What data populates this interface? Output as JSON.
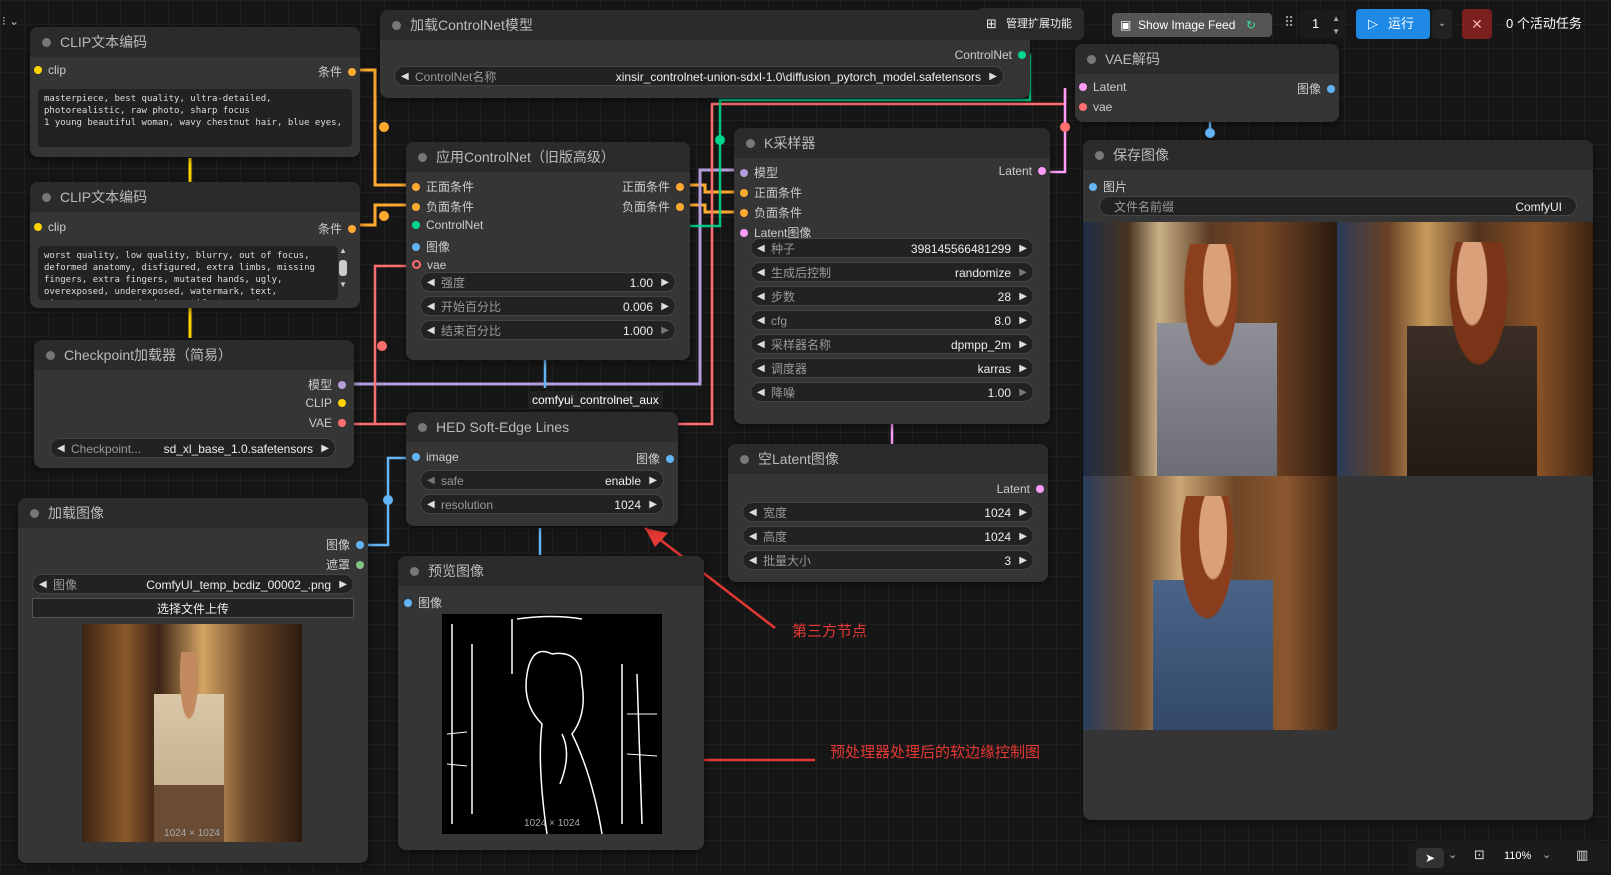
{
  "toolbar": {
    "manager_label": "管理扩展功能",
    "image_feed_label": "Show Image Feed",
    "queue_count": "1",
    "run_label": "运行",
    "active_tasks": "0 个活动任务"
  },
  "nodes": {
    "clip_pos": {
      "title": "CLIP文本编码",
      "in_clip": "clip",
      "out_cond": "条件",
      "text": "masterpiece, best quality, ultra-detailed, photorealistic, raw photo, sharp focus\n1 young beautiful woman, wavy chestnut hair, blue eyes,"
    },
    "clip_neg": {
      "title": "CLIP文本编码",
      "in_clip": "clip",
      "out_cond": "条件",
      "text": "worst quality, low quality, blurry, out of focus, deformed anatomy, disfigured, extra limbs, missing fingers, extra fingers, mutated hands, ugly, overexposed, underexposed, watermark, text, signature, cropped, jpeg artifacts, grainy"
    },
    "checkpoint": {
      "title": "Checkpoint加载器（简易）",
      "out_model": "模型",
      "out_clip": "CLIP",
      "out_vae": "VAE",
      "w_label": "Checkpoint...",
      "w_value": "sd_xl_base_1.0.safetensors"
    },
    "load_image": {
      "title": "加载图像",
      "out_image": "图像",
      "out_mask": "遮罩",
      "w_label": "图像",
      "w_value": "ComfyUI_temp_bcdiz_00002_.png",
      "upload_label": "选择文件上传",
      "caption": "1024 × 1024"
    },
    "cn_loader": {
      "title": "加载ControlNet模型",
      "out": "ControlNet",
      "w_label": "ControlNet名称",
      "w_value": "xinsir_controlnet-union-sdxl-1.0\\diffusion_pytorch_model.safetensors"
    },
    "apply_cn": {
      "title": "应用ControlNet（旧版高级）",
      "in_pos": "正面条件",
      "in_neg": "负面条件",
      "in_cn": "ControlNet",
      "in_image": "图像",
      "in_vae": "vae",
      "out_pos": "正面条件",
      "out_neg": "负面条件",
      "w1_label": "强度",
      "w1_value": "1.00",
      "w2_label": "开始百分比",
      "w2_value": "0.006",
      "w3_label": "结束百分比",
      "w3_value": "1.000"
    },
    "hed": {
      "title": "HED Soft-Edge Lines",
      "badge": "comfyui_controlnet_aux",
      "in_image": "image",
      "out_image": "图像",
      "w1_label": "safe",
      "w1_value": "enable",
      "w2_label": "resolution",
      "w2_value": "1024"
    },
    "preview": {
      "title": "预览图像",
      "in_image": "图像",
      "caption": "1024 × 1024"
    },
    "ksampler": {
      "title": "K采样器",
      "in_model": "模型",
      "in_pos": "正面条件",
      "in_neg": "负面条件",
      "in_latent": "Latent图像",
      "out_latent": "Latent",
      "widgets": [
        {
          "label": "种子",
          "value": "398145566481299"
        },
        {
          "label": "生成后控制",
          "value": "randomize"
        },
        {
          "label": "步数",
          "value": "28"
        },
        {
          "label": "cfg",
          "value": "8.0"
        },
        {
          "label": "采样器名称",
          "value": "dpmpp_2m"
        },
        {
          "label": "调度器",
          "value": "karras"
        },
        {
          "label": "降噪",
          "value": "1.00"
        }
      ]
    },
    "empty_latent": {
      "title": "空Latent图像",
      "out_latent": "Latent",
      "widgets": [
        {
          "label": "宽度",
          "value": "1024"
        },
        {
          "label": "高度",
          "value": "1024"
        },
        {
          "label": "批量大小",
          "value": "3"
        }
      ]
    },
    "vae_decode": {
      "title": "VAE解码",
      "in_latent": "Latent",
      "in_vae": "vae",
      "out_image": "图像"
    },
    "save_image": {
      "title": "保存图像",
      "in_image": "图片",
      "w_label": "文件名前缀",
      "w_value": "ComfyUI"
    }
  },
  "annotations": {
    "third_party": "第三方节点",
    "softedge": "预处理器处理后的软边缘控制图"
  },
  "bottom_bar": {
    "zoom": "110%"
  },
  "colors": {
    "clip": "#ffd500",
    "conditioning": "#ffa931",
    "model": "#b39ddb",
    "vae": "#ff6e6e",
    "image": "#64b5f6",
    "latent": "#ff9cf9",
    "controlnet": "#00d78d",
    "mask": "#81c784"
  }
}
